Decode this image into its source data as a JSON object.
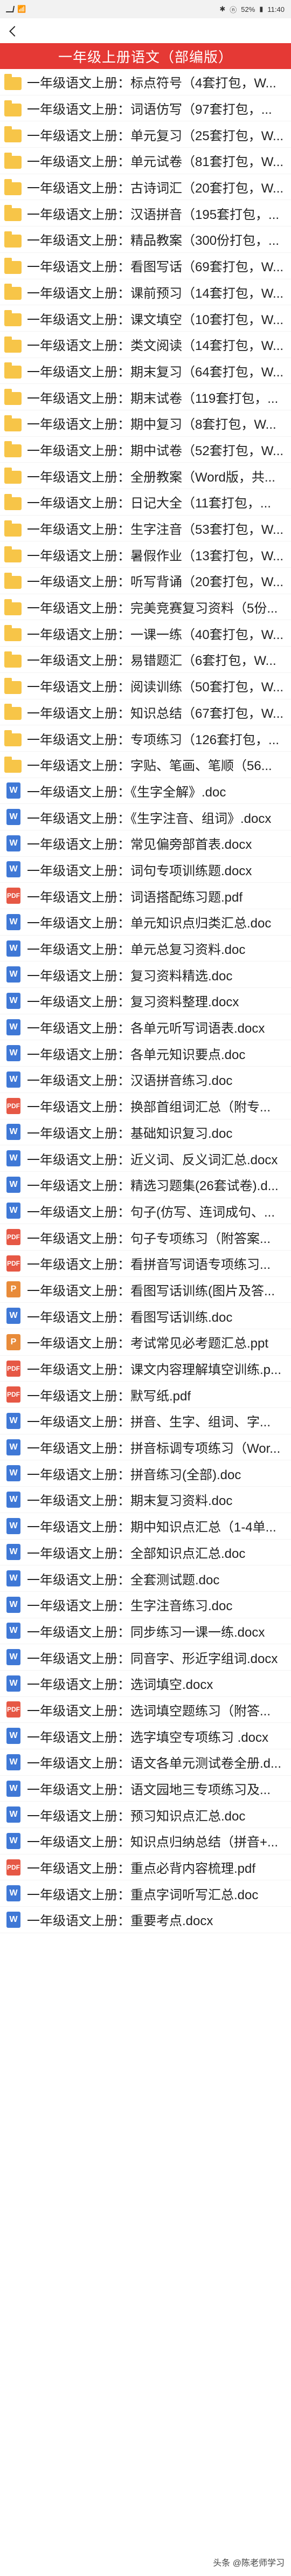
{
  "status_bar": {
    "left": "Wi-Fi",
    "battery": "52%",
    "time": "11:40"
  },
  "banner_title": "一年级上册语文（部编版）",
  "items": [
    {
      "type": "folder",
      "label": "一年级语文上册：标点符号（4套打包，W..."
    },
    {
      "type": "folder",
      "label": "一年级语文上册：词语仿写（97套打包，..."
    },
    {
      "type": "folder",
      "label": "一年级语文上册：单元复习（25套打包，W..."
    },
    {
      "type": "folder",
      "label": "一年级语文上册：单元试卷（81套打包，W..."
    },
    {
      "type": "folder",
      "label": "一年级语文上册：古诗词汇（20套打包，W..."
    },
    {
      "type": "folder",
      "label": "一年级语文上册：汉语拼音（195套打包，..."
    },
    {
      "type": "folder",
      "label": "一年级语文上册：精品教案（300份打包，..."
    },
    {
      "type": "folder",
      "label": "一年级语文上册：看图写话（69套打包，W..."
    },
    {
      "type": "folder",
      "label": "一年级语文上册：课前预习（14套打包，W..."
    },
    {
      "type": "folder",
      "label": "一年级语文上册：课文填空（10套打包，W..."
    },
    {
      "type": "folder",
      "label": "一年级语文上册：类文阅读（14套打包，W..."
    },
    {
      "type": "folder",
      "label": "一年级语文上册：期末复习（64套打包，W..."
    },
    {
      "type": "folder",
      "label": "一年级语文上册：期末试卷（119套打包，..."
    },
    {
      "type": "folder",
      "label": "一年级语文上册：期中复习（8套打包，W..."
    },
    {
      "type": "folder",
      "label": "一年级语文上册：期中试卷（52套打包，W..."
    },
    {
      "type": "folder",
      "label": "一年级语文上册：全册教案（Word版，共..."
    },
    {
      "type": "folder",
      "label": "一年级语文上册：日记大全（11套打包，..."
    },
    {
      "type": "folder",
      "label": "一年级语文上册：生字注音（53套打包，W..."
    },
    {
      "type": "folder",
      "label": "一年级语文上册：暑假作业（13套打包，W..."
    },
    {
      "type": "folder",
      "label": "一年级语文上册：听写背诵（20套打包，W..."
    },
    {
      "type": "folder",
      "label": "一年级语文上册：完美竞赛复习资料（5份..."
    },
    {
      "type": "folder",
      "label": "一年级语文上册：一课一练（40套打包，W..."
    },
    {
      "type": "folder",
      "label": "一年级语文上册：易错题汇（6套打包，W..."
    },
    {
      "type": "folder",
      "label": "一年级语文上册：阅读训练（50套打包，W..."
    },
    {
      "type": "folder",
      "label": "一年级语文上册：知识总结（67套打包，W..."
    },
    {
      "type": "folder",
      "label": "一年级语文上册：专项练习（126套打包，..."
    },
    {
      "type": "folder",
      "label": "一年级语文上册：字贴、笔画、笔顺（56..."
    },
    {
      "type": "docx",
      "label": "一年级语文上册：《生字全解》.doc"
    },
    {
      "type": "docx",
      "label": "一年级语文上册：《生字注音、组词》.docx"
    },
    {
      "type": "docx",
      "label": "一年级语文上册：常见偏旁部首表.docx"
    },
    {
      "type": "docx",
      "label": "一年级语文上册：词句专项训练题.docx"
    },
    {
      "type": "pdf",
      "label": "一年级语文上册：词语搭配练习题.pdf"
    },
    {
      "type": "docx",
      "label": "一年级语文上册：单元知识点归类汇总.doc"
    },
    {
      "type": "docx",
      "label": "一年级语文上册：单元总复习资料.doc"
    },
    {
      "type": "docx",
      "label": "一年级语文上册：复习资料精选.doc"
    },
    {
      "type": "docx",
      "label": "一年级语文上册：复习资料整理.docx"
    },
    {
      "type": "docx",
      "label": "一年级语文上册：各单元听写词语表.docx"
    },
    {
      "type": "docx",
      "label": "一年级语文上册：各单元知识要点.doc"
    },
    {
      "type": "docx",
      "label": "一年级语文上册：汉语拼音练习.doc"
    },
    {
      "type": "pdf",
      "label": "一年级语文上册：换部首组词汇总（附专..."
    },
    {
      "type": "docx",
      "label": "一年级语文上册：基础知识复习.doc"
    },
    {
      "type": "docx",
      "label": "一年级语文上册：近义词、反义词汇总.docx"
    },
    {
      "type": "docx",
      "label": "一年级语文上册：精选习题集(26套试卷).d..."
    },
    {
      "type": "docx",
      "label": "一年级语文上册：句子(仿写、连词成句、..."
    },
    {
      "type": "pdf",
      "label": "一年级语文上册：句子专项练习（附答案..."
    },
    {
      "type": "pdf",
      "label": "一年级语文上册：看拼音写词语专项练习..."
    },
    {
      "type": "ppt",
      "label": "一年级语文上册：看图写话训练(图片及答..."
    },
    {
      "type": "docx",
      "label": "一年级语文上册：看图写话训练.doc"
    },
    {
      "type": "ppt",
      "label": "一年级语文上册：考试常见必考题汇总.ppt"
    },
    {
      "type": "pdf",
      "label": "一年级语文上册：课文内容理解填空训练.p..."
    },
    {
      "type": "pdf",
      "label": "一年级语文上册：默写纸.pdf"
    },
    {
      "type": "docx",
      "label": "一年级语文上册：拼音、生字、组词、字..."
    },
    {
      "type": "docx",
      "label": "一年级语文上册：拼音标调专项练习（Wor..."
    },
    {
      "type": "docx",
      "label": "一年级语文上册：拼音练习(全部).doc"
    },
    {
      "type": "docx",
      "label": "一年级语文上册：期末复习资料.doc"
    },
    {
      "type": "docx",
      "label": "一年级语文上册：期中知识点汇总（1-4单..."
    },
    {
      "type": "docx",
      "label": "一年级语文上册：全部知识点汇总.doc"
    },
    {
      "type": "docx",
      "label": "一年级语文上册：全套测试题.doc"
    },
    {
      "type": "docx",
      "label": "一年级语文上册：生字注音练习.doc"
    },
    {
      "type": "docx",
      "label": "一年级语文上册：同步练习一课一练.docx"
    },
    {
      "type": "docx",
      "label": "一年级语文上册：同音字、形近字组词.docx"
    },
    {
      "type": "docx",
      "label": "一年级语文上册：选词填空.docx"
    },
    {
      "type": "pdf",
      "label": "一年级语文上册：选词填空题练习（附答..."
    },
    {
      "type": "docx",
      "label": "一年级语文上册：选字填空专项练习 .docx"
    },
    {
      "type": "docx",
      "label": "一年级语文上册：语文各单元测试卷全册.d..."
    },
    {
      "type": "docx",
      "label": "一年级语文上册：语文园地三专项练习及..."
    },
    {
      "type": "docx",
      "label": "一年级语文上册：预习知识点汇总.doc"
    },
    {
      "type": "docx",
      "label": "一年级语文上册：知识点归纳总结（拼音+..."
    },
    {
      "type": "pdf",
      "label": "一年级语文上册：重点必背内容梳理.pdf"
    },
    {
      "type": "docx",
      "label": "一年级语文上册：重点字词听写汇总.doc"
    },
    {
      "type": "docx",
      "label": "一年级语文上册：重要考点.docx"
    }
  ],
  "footer": "头条 @陈老师学习"
}
